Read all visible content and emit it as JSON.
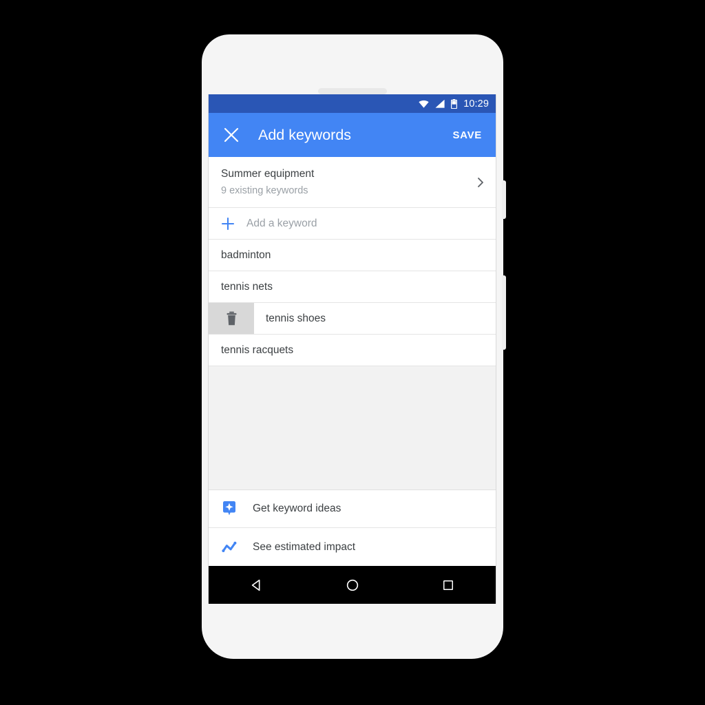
{
  "device": {
    "earpiece": "earpiece-speaker",
    "buttons": [
      "power-button",
      "volume-button"
    ]
  },
  "status_bar": {
    "time": "10:29",
    "icons": [
      "wifi-icon",
      "cellular-signal-icon",
      "battery-icon"
    ],
    "background": "#2a56b5"
  },
  "appbar": {
    "close_label": "close-icon",
    "title": "Add keywords",
    "save_label": "SAVE",
    "background": "#4285f4"
  },
  "list": {
    "header": {
      "title": "Summer equipment",
      "subtitle": "9 existing keywords",
      "chevron": "chevron-right-icon"
    },
    "add_keyword": {
      "placeholder": "Add a keyword",
      "icon": "plus-icon",
      "icon_color": "#4285f4"
    },
    "keywords": [
      {
        "text": "badminton",
        "swiped": false
      },
      {
        "text": "tennis nets",
        "swiped": false
      },
      {
        "text": "tennis shoes",
        "swiped": true,
        "action_label": "delete-icon"
      },
      {
        "text": "tennis racquets",
        "swiped": false
      }
    ]
  },
  "bottom_actions": [
    {
      "label": "Get keyword ideas",
      "icon": "keyword-ideas-icon",
      "color": "#4285f4"
    },
    {
      "label": "See estimated impact",
      "icon": "trend-line-icon",
      "color": "#4285f4"
    }
  ],
  "navbar": {
    "back": "back-triangle-icon",
    "home": "home-circle-icon",
    "recents": "recents-square-icon"
  }
}
